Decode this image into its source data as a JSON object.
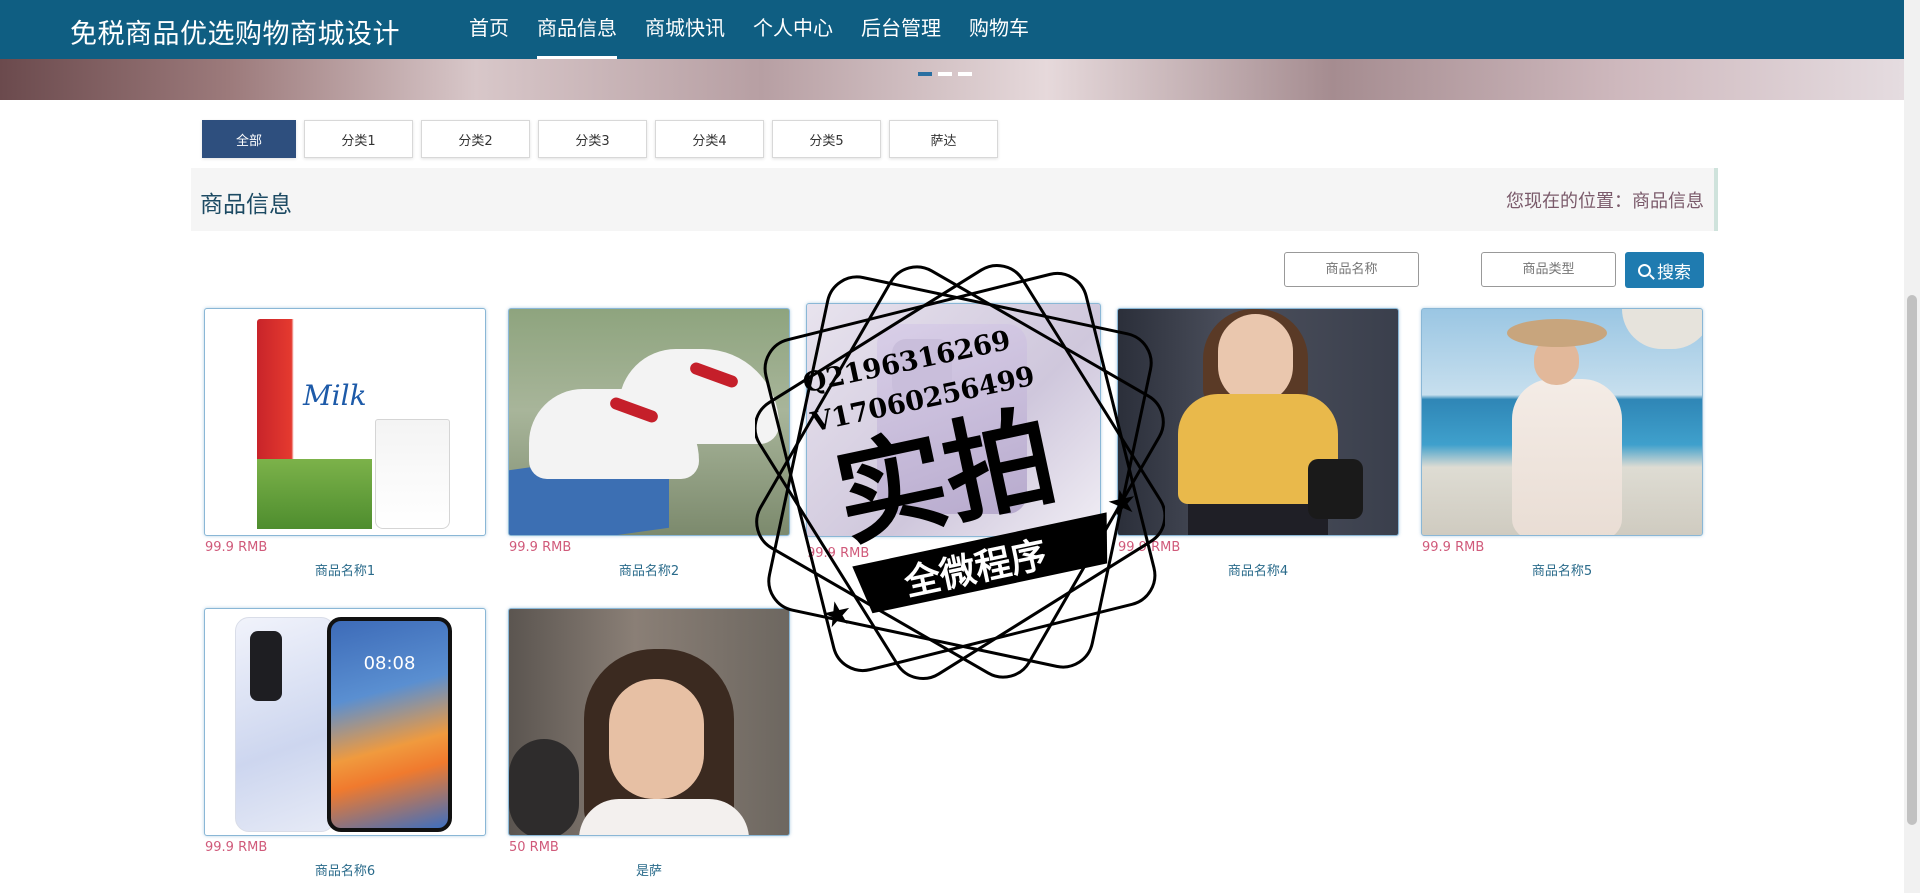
{
  "header": {
    "site_title": "免税商品优选购物商城设计",
    "nav": [
      "首页",
      "商品信息",
      "商城快讯",
      "个人中心",
      "后台管理",
      "购物车"
    ],
    "active_nav": "商品信息"
  },
  "filters": {
    "tabs": [
      "全部",
      "分类1",
      "分类2",
      "分类3",
      "分类4",
      "分类5",
      "萨达"
    ],
    "active": "全部"
  },
  "section": {
    "title": "商品信息",
    "breadcrumb": "您现在的位置：商品信息"
  },
  "search": {
    "name_placeholder": "商品名称",
    "type_placeholder": "商品类型",
    "button_label": "搜索"
  },
  "products": [
    {
      "price": "99.9 RMB",
      "name": "商品名称1",
      "image": "milk-carton"
    },
    {
      "price": "99.9 RMB",
      "name": "商品名称2",
      "image": "sneakers"
    },
    {
      "price": "99.9 RMB",
      "name": "",
      "image": "phone-back"
    },
    {
      "price": "99.9 RMB",
      "name": "商品名称4",
      "image": "woman-yellow-sweater"
    },
    {
      "price": "99.9 RMB",
      "name": "商品名称5",
      "image": "woman-beach-dress"
    },
    {
      "price": "99.9 RMB",
      "name": "商品名称6",
      "image": "smartphone"
    },
    {
      "price": "50 RMB",
      "name": "是萨",
      "image": "woman-portrait"
    }
  ],
  "phone_screen_time": "08:08",
  "watermark": {
    "line1": "Q2196316269",
    "line2": "V17060256499",
    "big": "实拍",
    "ribbon": "全微程序"
  },
  "colors": {
    "header_bg": "#0f5e82",
    "active_tab": "#2e4f7e",
    "search_button": "#1f7bb0",
    "price": "#d05a7a",
    "product_name": "#2a6b8b"
  }
}
